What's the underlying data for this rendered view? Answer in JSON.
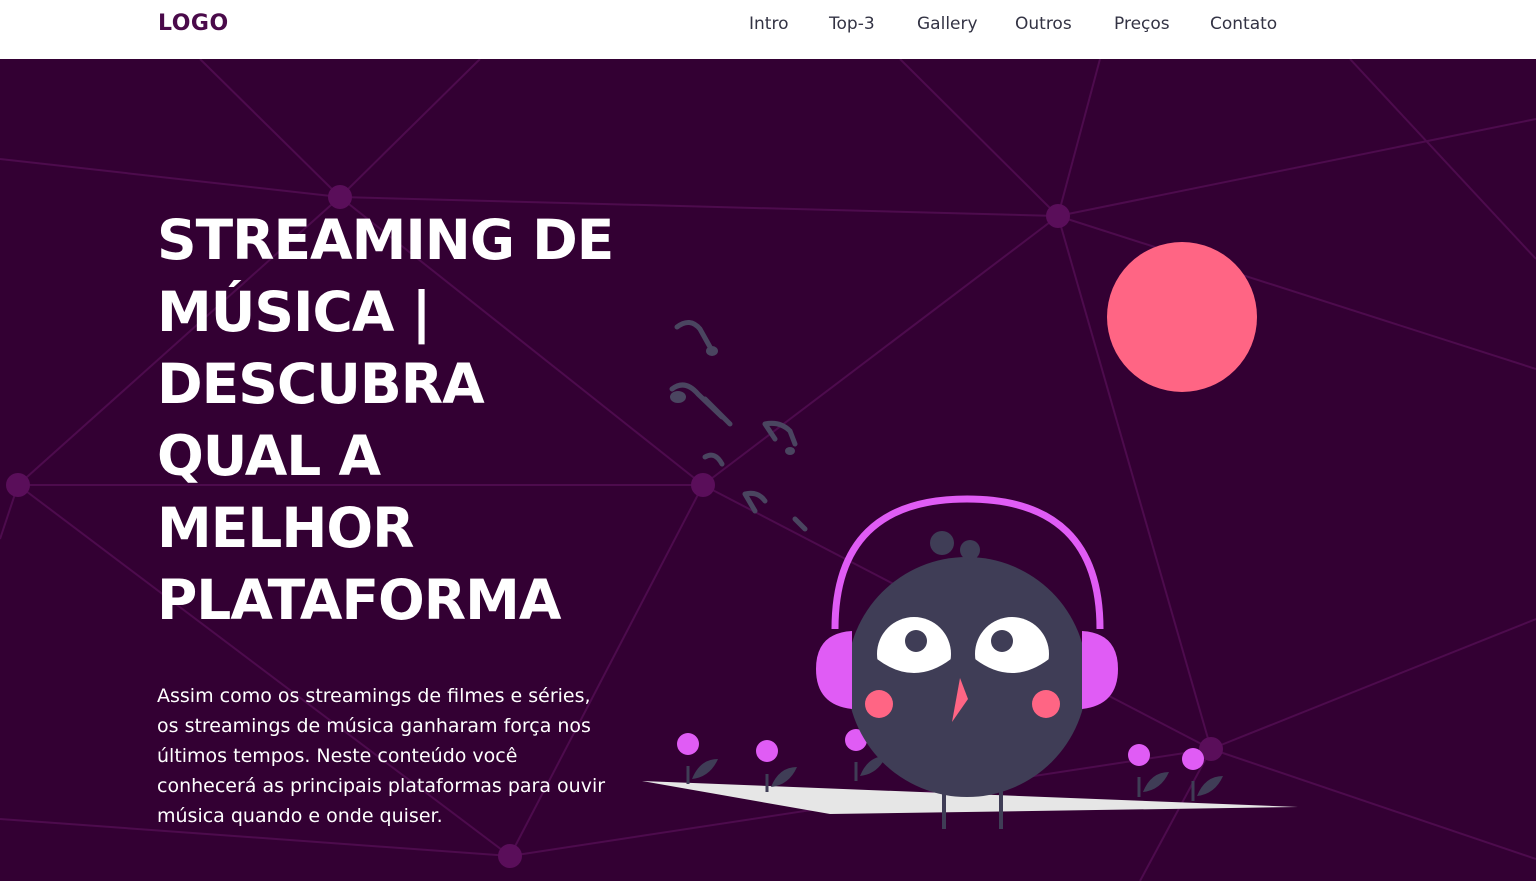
{
  "navbar": {
    "logo": "LOGO",
    "links": [
      "Intro",
      "Top-3",
      "Gallery",
      "Outros",
      "Preços",
      "Contato"
    ]
  },
  "hero": {
    "title": "STREAMING DE MÚSICA | DESCUBRA QUAL A MELHOR PLATAFORMA",
    "text": "Assim como os streamings de filmes e séries, os streamings de música ganharam força nos últimos tempos. Neste conteúdo você conhecerá as principais plataformas para ouvir música quando e onde quiser."
  },
  "colors": {
    "background": "#330033",
    "accent_sun": "#ff6584",
    "headphones": "#e05cf5",
    "bird": "#3f3d56",
    "ground": "#e6e6e6"
  },
  "icons": [
    "music-notes-icon",
    "bird-with-headphones-illustration"
  ]
}
